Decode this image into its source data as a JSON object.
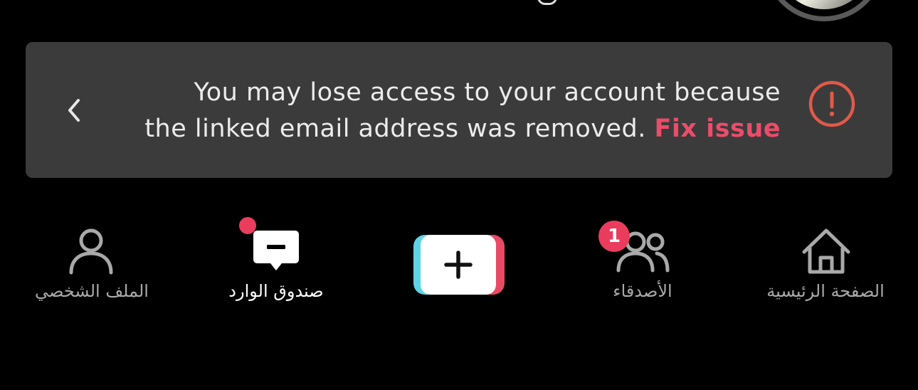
{
  "banner": {
    "message_line1": "You may lose access to your account because",
    "message_line2": "the linked email address was removed.",
    "fix_label": "Fix issue",
    "alert_color": "#e2594a",
    "fix_color": "#ec4c6a"
  },
  "nav": {
    "home_label": "الصفحة الرئيسية",
    "friends_label": "الأصدقاء",
    "friends_badge": "1",
    "inbox_label": "صندوق الوارد",
    "profile_label": "الملف الشخصي",
    "active": "inbox"
  },
  "icons": {
    "back": "chevron-left-icon",
    "alert": "exclamation-circle-icon",
    "home": "home-icon",
    "friends": "friends-icon",
    "create": "plus-icon",
    "inbox": "message-icon",
    "profile": "person-icon"
  }
}
